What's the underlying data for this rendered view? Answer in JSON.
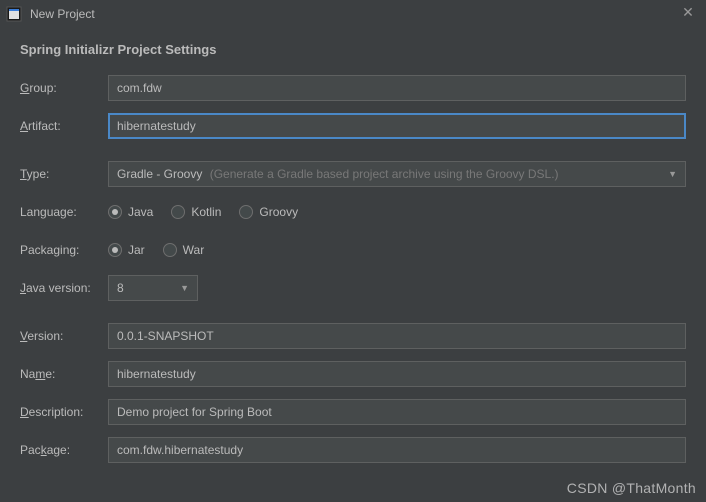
{
  "titlebar": {
    "title": "New Project"
  },
  "heading": "Spring Initializr Project Settings",
  "fields": {
    "group": {
      "label_pre": "",
      "mnemonic": "G",
      "label_post": "roup:",
      "value": "com.fdw"
    },
    "artifact": {
      "label_pre": "",
      "mnemonic": "A",
      "label_post": "rtifact:",
      "value": "hibernatestudy"
    },
    "type": {
      "label_pre": "",
      "mnemonic": "T",
      "label_post": "ype:",
      "value": "Gradle - Groovy",
      "hint": "(Generate a Gradle based project archive using the Groovy DSL.)"
    },
    "language": {
      "label": "Language:",
      "options": [
        "Java",
        "Kotlin",
        "Groovy"
      ],
      "selected": "Java"
    },
    "packaging": {
      "label": "Packaging:",
      "options": [
        "Jar",
        "War"
      ],
      "selected": "Jar"
    },
    "javaVersion": {
      "label_pre": "",
      "mnemonic": "J",
      "label_post": "ava version:",
      "value": "8"
    },
    "version": {
      "label_pre": "",
      "mnemonic": "V",
      "label_post": "ersion:",
      "value": "0.0.1-SNAPSHOT"
    },
    "name": {
      "label_pre": "Na",
      "mnemonic": "m",
      "label_post": "e:",
      "value": "hibernatestudy"
    },
    "description": {
      "label_pre": "",
      "mnemonic": "D",
      "label_post": "escription:",
      "value": "Demo project for Spring Boot"
    },
    "package": {
      "label_pre": "Pac",
      "mnemonic": "k",
      "label_post": "age:",
      "value": "com.fdw.hibernatestudy"
    }
  },
  "watermark": "CSDN @ThatMonth"
}
